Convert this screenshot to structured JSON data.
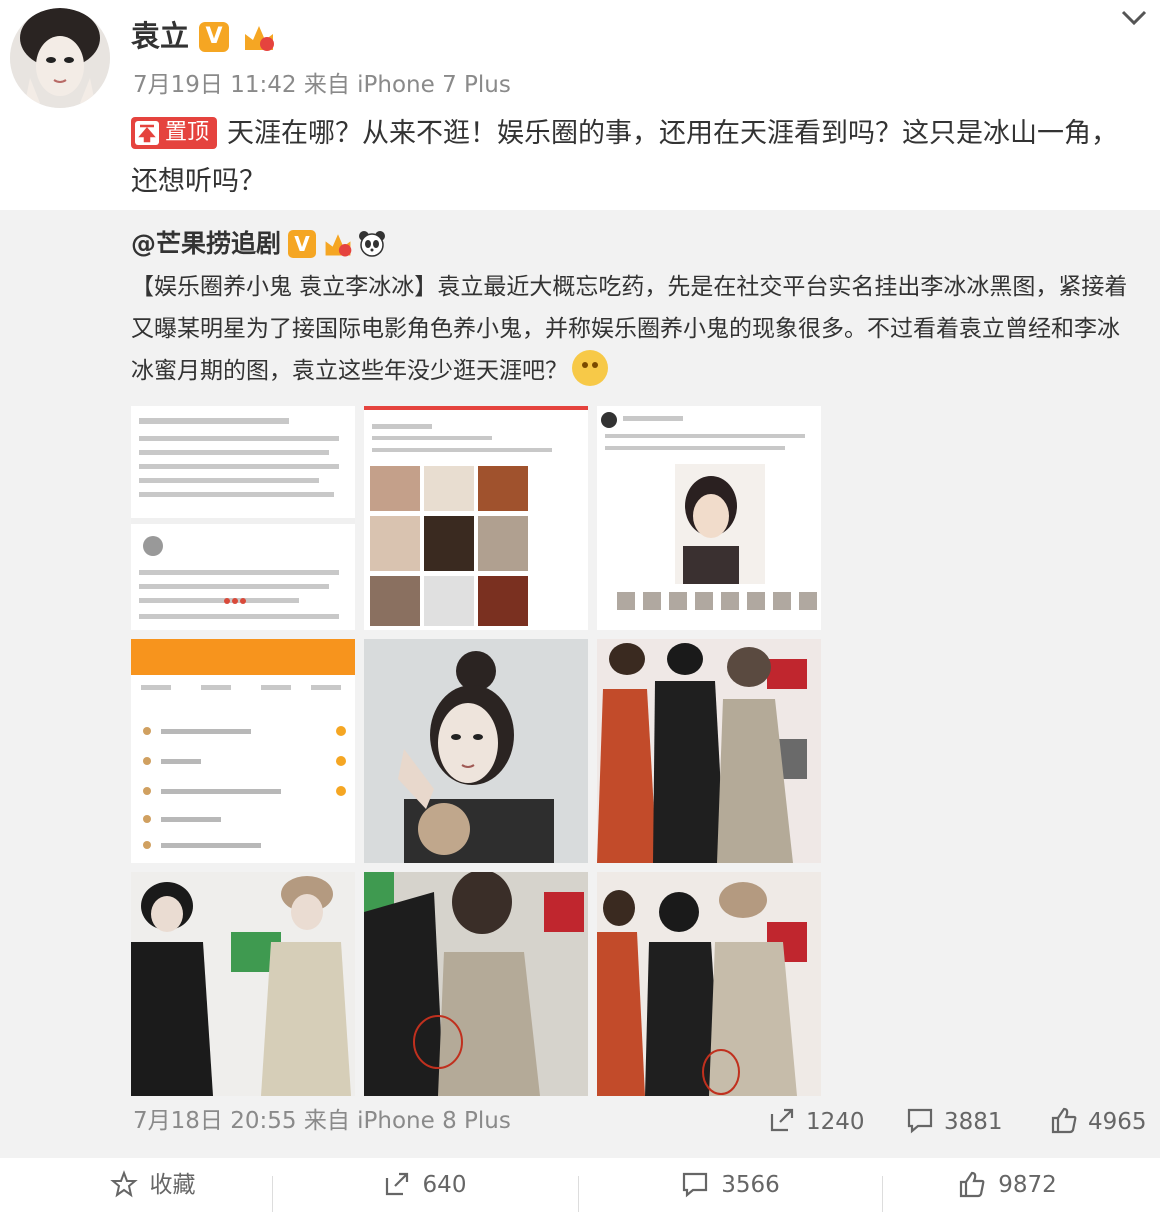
{
  "post": {
    "username": "袁立",
    "verified_badge": "V",
    "timestamp": "7月19日 11:42",
    "source": "来自 iPhone 7 Plus",
    "pin_label": "置顶",
    "text": "天涯在哪？从来不逛！娱乐圈的事，还用在天涯看到吗？这只是冰山一角，还想听吗？"
  },
  "repost": {
    "username": "@芒果捞追剧",
    "verified_badge": "V",
    "tag": "【娱乐圈养小鬼 袁立李冰冰】",
    "text": "袁立最近大概忘吃药，先是在社交平台实名挂出李冰冰黑图，紧接着又曝某明星为了接国际电影角色养小鬼，并称娱乐圈养小鬼的现象很多。不过看着袁立曾经和李冰冰蜜月期的图，袁立这些年没少逛天涯吧？",
    "timestamp": "7月18日 20:55",
    "source": "来自 iPhone 8 Plus",
    "reposts": "1240",
    "comments": "3881",
    "likes": "4965"
  },
  "toolbar": {
    "favorite_label": "收藏",
    "reposts": "640",
    "comments": "3566",
    "likes": "9872"
  },
  "colors": {
    "accent_red": "#e5433e",
    "verified_orange": "#f5a623",
    "meta_gray": "#8a8a8a",
    "repost_bg": "#f2f2f2"
  },
  "icons": [
    "chevron-down-icon",
    "verified-icon",
    "member-icon",
    "panda-icon",
    "pin-icon",
    "smile-icon",
    "repost-icon",
    "comment-icon",
    "like-icon",
    "star-icon"
  ]
}
